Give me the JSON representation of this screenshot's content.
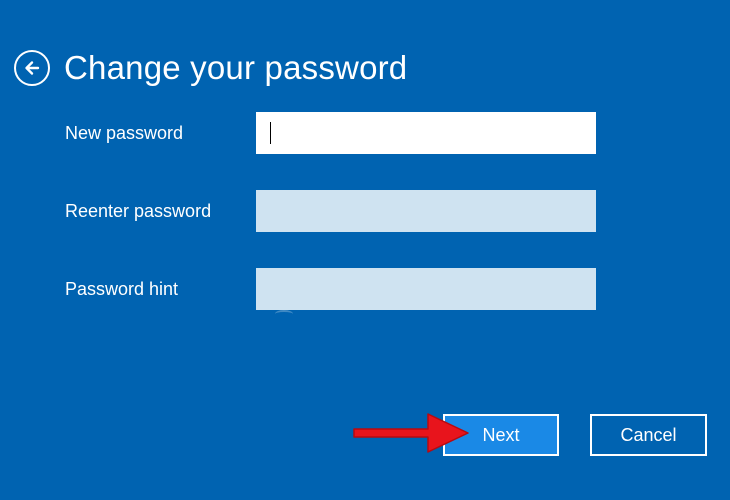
{
  "header": {
    "back_icon": "back-arrow-icon",
    "title": "Change your password"
  },
  "form": {
    "new_password": {
      "label": "New password",
      "value": ""
    },
    "reenter_password": {
      "label": "Reenter password",
      "value": ""
    },
    "password_hint": {
      "label": "Password hint",
      "value": ""
    }
  },
  "actions": {
    "next_label": "Next",
    "cancel_label": "Cancel"
  },
  "annotation": {
    "icon": "red-pointer-arrow-icon",
    "color": "#e8141c"
  },
  "colors": {
    "background": "#0063b1",
    "input_inactive": "#cfe3f1",
    "input_active": "#ffffff",
    "primary_button": "#1a89e6"
  }
}
